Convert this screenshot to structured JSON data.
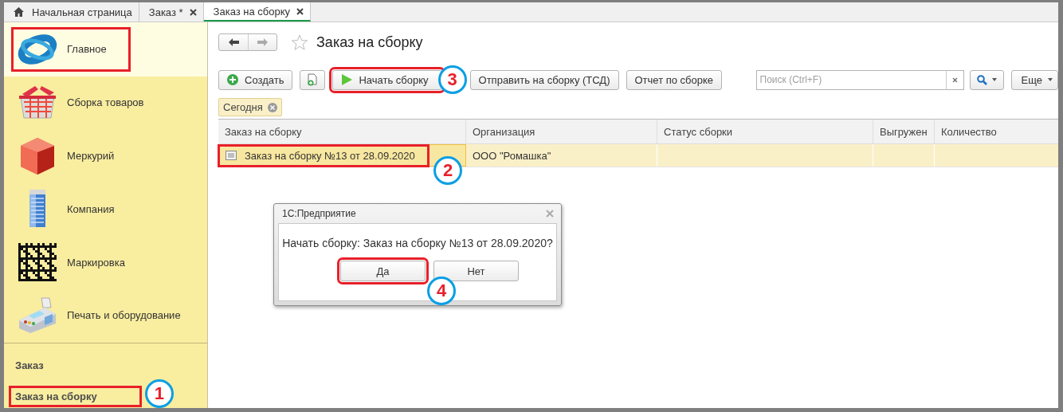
{
  "tabs": [
    {
      "label": "Начальная страница",
      "kind": "home",
      "selected": false
    },
    {
      "label": "Заказ *",
      "kind": "closable",
      "selected": false
    },
    {
      "label": "Заказ на сборку",
      "kind": "closable",
      "selected": true
    }
  ],
  "sidebar": {
    "sections": [
      {
        "label": "Главное",
        "kind": "logo",
        "selected": true,
        "highlighted": true
      },
      {
        "label": "Сборка товаров",
        "kind": "basket",
        "selected": false,
        "highlighted": false
      },
      {
        "label": "Меркурий",
        "kind": "cube",
        "selected": false,
        "highlighted": false
      },
      {
        "label": "Компания",
        "kind": "building",
        "selected": false,
        "highlighted": false
      },
      {
        "label": "Маркировка",
        "kind": "matrix",
        "selected": false,
        "highlighted": false
      },
      {
        "label": "Печать и оборудование",
        "kind": "terminal",
        "selected": false,
        "highlighted": false
      }
    ],
    "links": [
      {
        "label": "Заказ",
        "highlighted": false
      },
      {
        "label": "Заказ на сборку",
        "highlighted": true,
        "callout": "1"
      }
    ]
  },
  "form": {
    "title": "Заказ на сборку",
    "toolbar": [
      {
        "kind": "create",
        "label": "Создать",
        "highlighted": false
      },
      {
        "kind": "add-doc",
        "highlighted": false
      },
      {
        "kind": "start",
        "label": "Начать сборку",
        "highlighted": true,
        "callout": "3"
      },
      {
        "kind": "plain",
        "label": "Отправить на сборку (ТСД)",
        "highlighted": false
      },
      {
        "kind": "plain",
        "label": "Отчет по сборке",
        "highlighted": false
      }
    ],
    "search": {
      "placeholder": "Поиск (Ctrl+F)"
    },
    "more_button": "Еще",
    "filters": [
      {
        "label": "Сегодня"
      }
    ],
    "table": {
      "columns": [
        "Заказ на сборку",
        "Организация",
        "Статус сборки",
        "Выгружен",
        "Количество"
      ],
      "rows": [
        {
          "selected": true,
          "cells": [
            "Заказ на сборку №13 от 28.09.2020",
            "ООО \"Ромашка\""
          ],
          "highlighted": true,
          "callout": "2"
        }
      ]
    }
  },
  "dialog": {
    "title": "1C:Предприятие",
    "message": "Начать сборку: Заказ на сборку №13 от 28.09.2020?",
    "buttons": [
      {
        "label": "Да",
        "highlighted": true,
        "callout": "4"
      },
      {
        "label": "Нет",
        "highlighted": false
      }
    ]
  }
}
